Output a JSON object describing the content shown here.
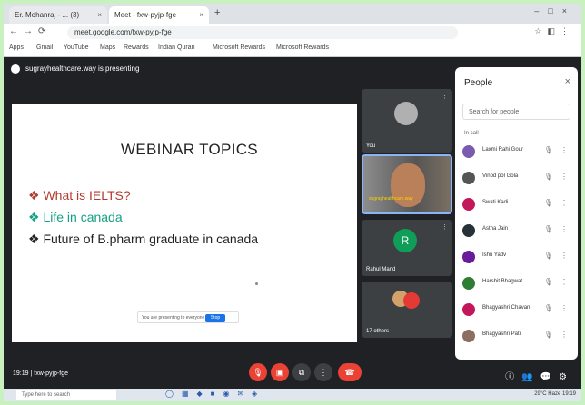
{
  "browser": {
    "tabs": [
      {
        "label": "Er. Mohanraj - ... (3)"
      },
      {
        "label": "Meet - fxw-pyjp-fge"
      }
    ],
    "url": "meet.google.com/fxw-pyjp-fge",
    "bookmarks": [
      "Apps",
      "Gmail",
      "YouTube",
      "Maps",
      "Rewards",
      "Indian Quran",
      "Microsoft Rewards",
      "Microsoft Rewards"
    ]
  },
  "meet": {
    "presenting_text": "sugrayhealthcare.way is presenting",
    "slide": {
      "title": "WEBINAR TOPICS",
      "bullets": [
        "❖ What is IELTS?",
        "❖ Life in canada",
        "❖ Future of  B.pharm graduate in canada"
      ],
      "share_text": "You are presenting to everyone",
      "stop_label": "Stop"
    },
    "tiles": [
      {
        "name": "You"
      },
      {
        "name": "sugrayhealthcare.way"
      },
      {
        "name": "Rahul Mand",
        "initial": "R"
      },
      {
        "name": "17 others"
      }
    ],
    "time": "19:19",
    "meeting_code": "fxw-pyjp-fge"
  },
  "people": {
    "title": "People",
    "search_placeholder": "Search for people",
    "section": "In call",
    "list": [
      {
        "name": "Laxmi Rahi Gour",
        "color": "#7b5bb0"
      },
      {
        "name": "Vinod pol Gola",
        "color": "#555555"
      },
      {
        "name": "Swati Kadi",
        "color": "#c2185b"
      },
      {
        "name": "Astha Jain",
        "color": "#263238"
      },
      {
        "name": "Ishu Yadv",
        "color": "#6a1b9a"
      },
      {
        "name": "Harshit Bhagwat",
        "color": "#2e7d32"
      },
      {
        "name": "Bhagyashri Chavan",
        "color": "#c2185b"
      },
      {
        "name": "Bhagyashri Patil",
        "color": "#8d6e63"
      }
    ]
  },
  "taskbar": {
    "search_placeholder": "Type here to search",
    "weather": "29°C Haze",
    "clock": "19:19"
  },
  "colors": {
    "meet_bg": "#202124",
    "leave": "#ea4335",
    "accent": "#1a73e8"
  }
}
